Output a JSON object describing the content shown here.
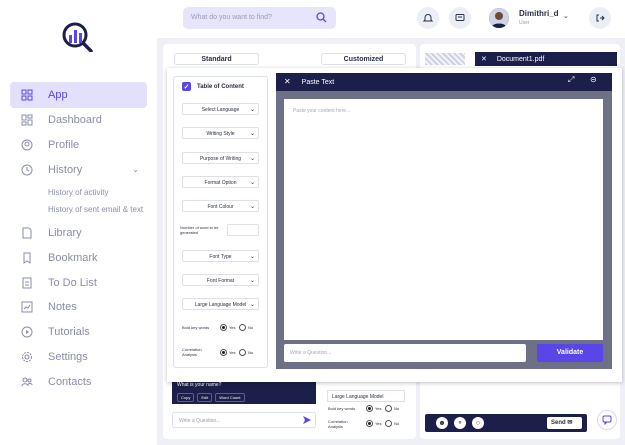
{
  "sidebar": {
    "items": [
      {
        "label": "App",
        "icon": "app-grid-icon",
        "active": true
      },
      {
        "label": "Dashboard",
        "icon": "dashboard-icon"
      },
      {
        "label": "Profile",
        "icon": "profile-icon"
      },
      {
        "label": "History",
        "icon": "history-icon",
        "has_submenu": true
      },
      {
        "label": "Library",
        "icon": "library-icon"
      },
      {
        "label": "Bookmark",
        "icon": "bookmark-icon"
      },
      {
        "label": "To Do List",
        "icon": "todo-icon"
      },
      {
        "label": "Notes",
        "icon": "notes-icon"
      },
      {
        "label": "Tutorials",
        "icon": "tutorials-icon"
      },
      {
        "label": "Settings",
        "icon": "settings-icon"
      },
      {
        "label": "Contacts",
        "icon": "contacts-icon"
      }
    ],
    "history_sub": [
      "History of activity",
      "History of sent email & text"
    ]
  },
  "header": {
    "search_placeholder": "What do you want to find?",
    "user_name": "Dimithri_d",
    "user_role": "User"
  },
  "workspace": {
    "tab_standard": "Standard",
    "tab_customized": "Customized",
    "doc_name": "Document1.pdf",
    "chat_question": "What is your name?",
    "chat_tools": [
      "Copy",
      "Edit",
      "Word Count"
    ],
    "chat_placeholder": "Write a Question...",
    "bg_llm": "Large Language Model",
    "bg_bold": "Bold key words",
    "bg_corr": "Correlation Analysis",
    "yes": "Yes",
    "no": "No",
    "send_label": "Send"
  },
  "form": {
    "toc_label": "Table of Content",
    "select_language": "Select Language",
    "writing_style": "Writing Style",
    "purpose": "Purpose of Writing",
    "format_option": "Format Option",
    "font_colour": "Font Colour",
    "num_words_label": "Number of word to be generated",
    "font_type": "Font Type",
    "font_format": "Font Format",
    "llm": "Large Language Model",
    "bold_key_words": "Bold key words",
    "correlation": "Correlation Analysis",
    "yes": "Yes",
    "no": "No"
  },
  "paste": {
    "title": "Paste Text",
    "placeholder": "Paste your content here...",
    "question_placeholder": "Write a Question...",
    "validate_label": "Validate"
  },
  "colors": {
    "accent": "#5a46e8",
    "navy": "#1c1f4a",
    "active_bg": "#e2e0fb"
  }
}
